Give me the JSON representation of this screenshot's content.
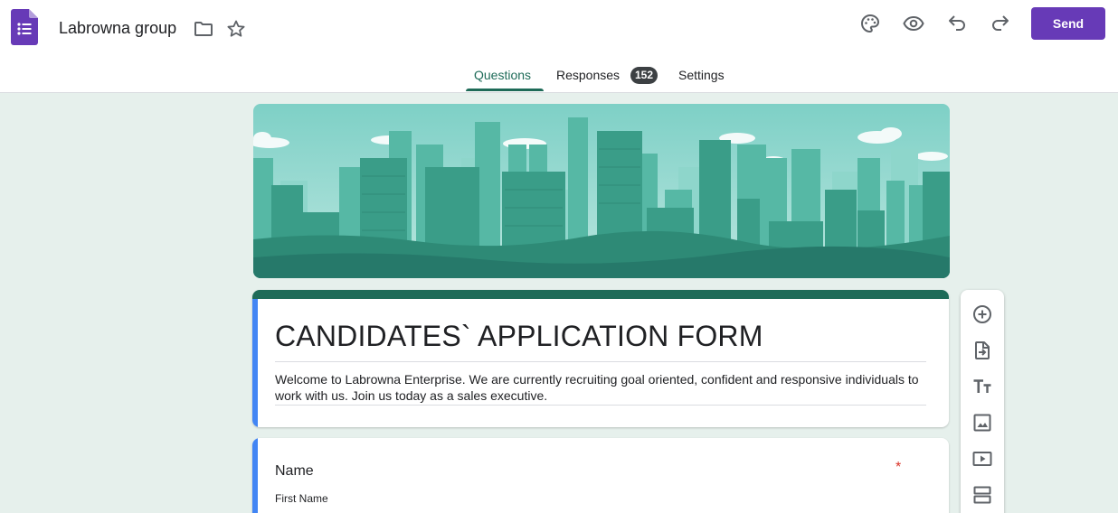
{
  "header": {
    "doc_title": "Labrowna group",
    "send_label": "Send",
    "icons": [
      "folder-icon",
      "star-icon",
      "palette-icon",
      "preview-icon",
      "undo-icon",
      "redo-icon"
    ]
  },
  "tabs": {
    "questions": "Questions",
    "responses": "Responses",
    "responses_count": "152",
    "settings": "Settings"
  },
  "form": {
    "title": "CANDIDATES` APPLICATION FORM",
    "description": "Welcome to Labrowna Enterprise. We are currently recruiting goal oriented, confident and responsive individuals to work with us. Join us today as a sales executive."
  },
  "question": {
    "title": "Name",
    "required_mark": "*",
    "sub_label": "First Name"
  },
  "toolbar": [
    "add-question-icon",
    "import-questions-icon",
    "add-title-icon",
    "add-image-icon",
    "add-video-icon",
    "add-section-icon"
  ],
  "colors": {
    "accent": "#673ab7",
    "theme": "#1e6b58",
    "background": "#e6f0ec",
    "left_bar": "#4285f4",
    "required": "#d93025"
  }
}
